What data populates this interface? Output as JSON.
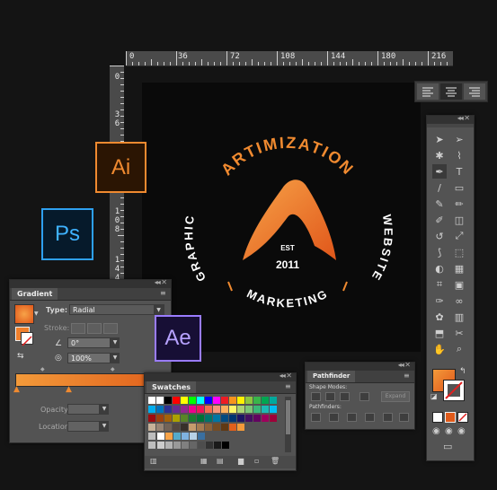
{
  "ruler": {
    "h_labels": [
      "0",
      "36",
      "72",
      "108",
      "144",
      "180",
      "216"
    ],
    "v_labels": [
      "0",
      "3 6",
      "7 2",
      "1 0 8",
      "1 4 4"
    ]
  },
  "logo": {
    "top_text": "ARTIMIZATION",
    "left_text": "GRAPHIC",
    "bottom_text": "MARKETING",
    "right_text": "WEBSITE",
    "est": "EST",
    "year": "2011",
    "colors": {
      "orange": "#f08a30",
      "orange_dark": "#e05a1a",
      "white": "#ffffff"
    }
  },
  "app_icons": {
    "illustrator": "Ai",
    "photoshop": "Ps",
    "after_effects": "Ae"
  },
  "gradient_panel": {
    "tab": "Gradient",
    "type_label": "Type:",
    "type_value": "Radial",
    "stroke_label": "Stroke:",
    "angle_value": "0°",
    "ratio_value": "100%",
    "opacity_label": "Opacity:",
    "location_label": "Location:",
    "gradient_start": "#f39a3a",
    "gradient_end": "#e0601c"
  },
  "swatches_panel": {
    "tab": "Swatches"
  },
  "pathfinder_panel": {
    "tab": "Pathfinder",
    "shape_modes_label": "Shape Modes:",
    "expand_label": "Expand",
    "pathfinders_label": "Pathfinders:"
  },
  "toolbar": {
    "tools": [
      "selection-tool",
      "direct-selection-tool",
      "magic-wand-tool",
      "lasso-tool",
      "pen-tool",
      "type-tool",
      "line-tool",
      "rectangle-tool",
      "paintbrush-tool",
      "pencil-tool",
      "blob-brush-tool",
      "eraser-tool",
      "rotate-tool",
      "scale-tool",
      "width-tool",
      "free-transform-tool",
      "shape-builder-tool",
      "perspective-grid-tool",
      "mesh-tool",
      "gradient-tool",
      "eyedropper-tool",
      "blend-tool",
      "symbol-sprayer-tool",
      "column-graph-tool",
      "artboard-tool",
      "slice-tool",
      "hand-tool",
      "zoom-tool"
    ],
    "fill_color": "#ef7f2c"
  }
}
